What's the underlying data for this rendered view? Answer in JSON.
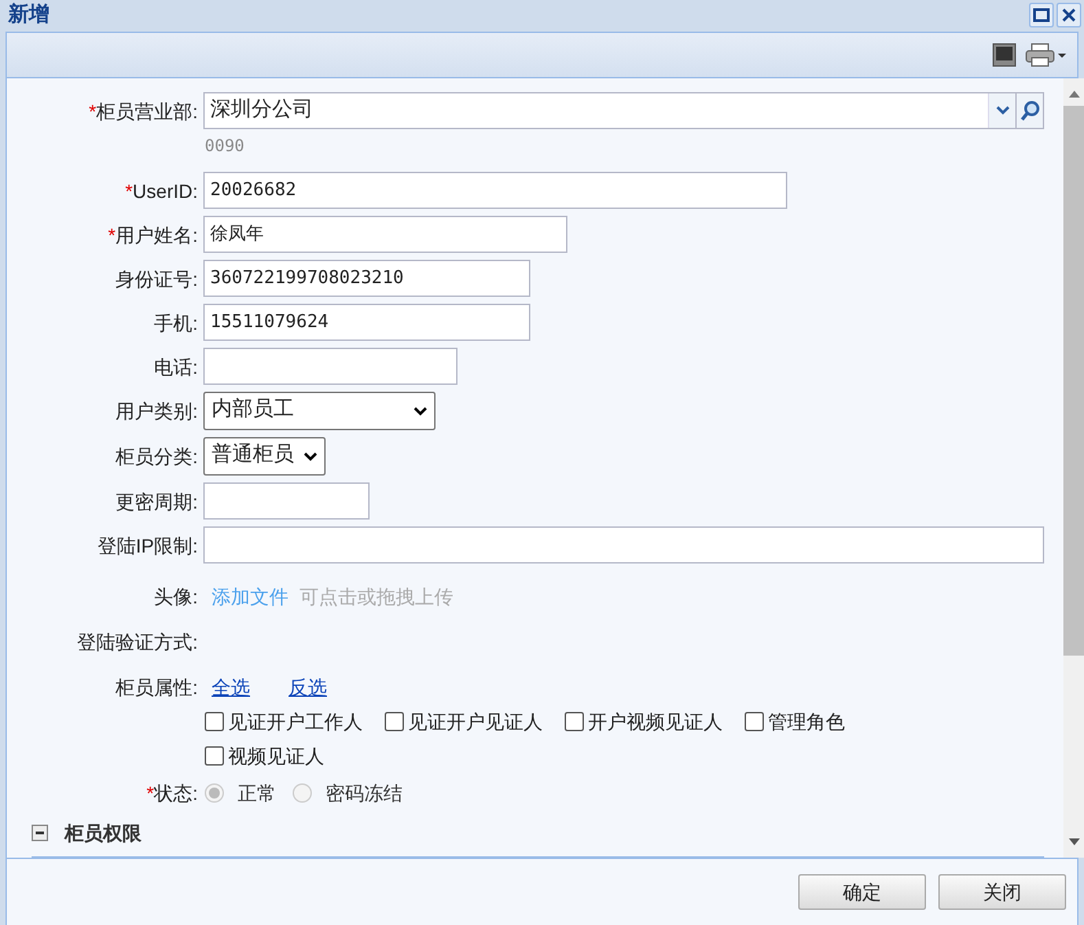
{
  "window": {
    "title": "新增"
  },
  "fields": [
    {
      "kind": "combo",
      "mark": "*",
      "label": "柜员营业部:",
      "value": "深圳分公司",
      "hint": "0090"
    },
    {
      "kind": "text",
      "mark": "*",
      "label": "UserID:",
      "value": "20026682"
    },
    {
      "kind": "text",
      "mark": "*",
      "label": "用户姓名:",
      "value": "徐凤年"
    },
    {
      "kind": "text",
      "label": "身份证号:",
      "value": "360722199708023210"
    },
    {
      "kind": "text",
      "label": "手机:",
      "value": "15511079624"
    },
    {
      "kind": "text",
      "label": "电话:"
    },
    {
      "kind": "select",
      "label": "用户类别:",
      "value": "内部员工"
    },
    {
      "kind": "select",
      "label": "柜员分类:",
      "value": "普通柜员"
    },
    {
      "kind": "text",
      "label": "更密周期:"
    },
    {
      "kind": "text",
      "label": "登陆IP限制:"
    },
    {
      "kind": "upload",
      "label": "头像:",
      "link": "添加文件",
      "note": "可点击或拖拽上传"
    },
    {
      "kind": "plain",
      "label": "登陆验证方式:"
    },
    {
      "kind": "checks",
      "label": "柜员属性:",
      "links": [
        "全选",
        "反选"
      ],
      "options": [
        {
          "label": "见证开户工作人",
          "checked": false
        },
        {
          "label": "见证开户见证人",
          "checked": false
        },
        {
          "label": "开户视频见证人",
          "checked": false
        },
        {
          "label": "管理角色",
          "checked": false
        },
        {
          "label": "视频见证人",
          "checked": false
        }
      ]
    },
    {
      "kind": "radio",
      "mark": "*",
      "label": "状态:",
      "options": [
        {
          "label": "正常",
          "selected": true,
          "disabled": true
        },
        {
          "label": "密码冻结",
          "selected": false,
          "disabled": true
        }
      ]
    }
  ],
  "section": {
    "title": "柜员权限",
    "expanded": true
  },
  "buttons": [
    "确定",
    "关闭"
  ]
}
